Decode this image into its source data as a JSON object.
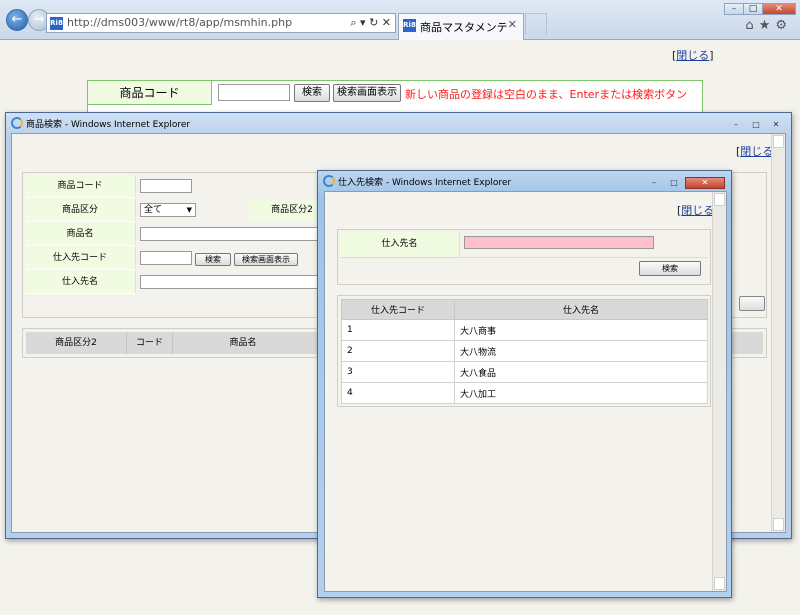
{
  "browser": {
    "url": "http://dms003/www/rt8/app/msmhin.php",
    "address_tools": "⌕ ▾ ↻ ✕",
    "tab_title": "商品マスタメンテ",
    "favicon_text": "Ri8",
    "icons": [
      "home-icon",
      "star-icon",
      "gear-icon"
    ]
  },
  "main": {
    "close_link": "閉じる",
    "product_code_label": "商品コード",
    "search_button": "検索",
    "search_screen_button": "検索画面表示",
    "hint": "新しい商品の登録は空白のまま、Enterまたは検索ボタン"
  },
  "product_window": {
    "title": "商品検索 - Windows Internet Explorer",
    "close_link": "閉じる",
    "form": {
      "product_code_label": "商品コード",
      "product_class_label": "商品区分",
      "product_class_value": "全て",
      "product_class2_label": "商品区分2",
      "product_name_label": "商品名",
      "supplier_code_label": "仕入先コード",
      "search_button": "検索",
      "search_screen_button": "検索画面表示",
      "supplier_name_label": "仕入先名"
    },
    "results_headers": [
      "商品区分2",
      "コード",
      "商品名"
    ]
  },
  "supplier_window": {
    "title": "仕入先検索 - Windows Internet Explorer",
    "close_link": "閉じる",
    "supplier_name_label": "仕入先名",
    "supplier_name_value": "",
    "search_button": "検索",
    "table": {
      "headers": [
        "仕入先コード",
        "仕入先名"
      ],
      "rows": [
        [
          "1",
          "大八商事"
        ],
        [
          "2",
          "大八物流"
        ],
        [
          "3",
          "大八食品"
        ],
        [
          "4",
          "大八加工"
        ]
      ]
    }
  },
  "colors": {
    "label_bg": "#f0fbe2",
    "hint_red": "#ff1a1a",
    "required_input": "#ffc0cb"
  }
}
